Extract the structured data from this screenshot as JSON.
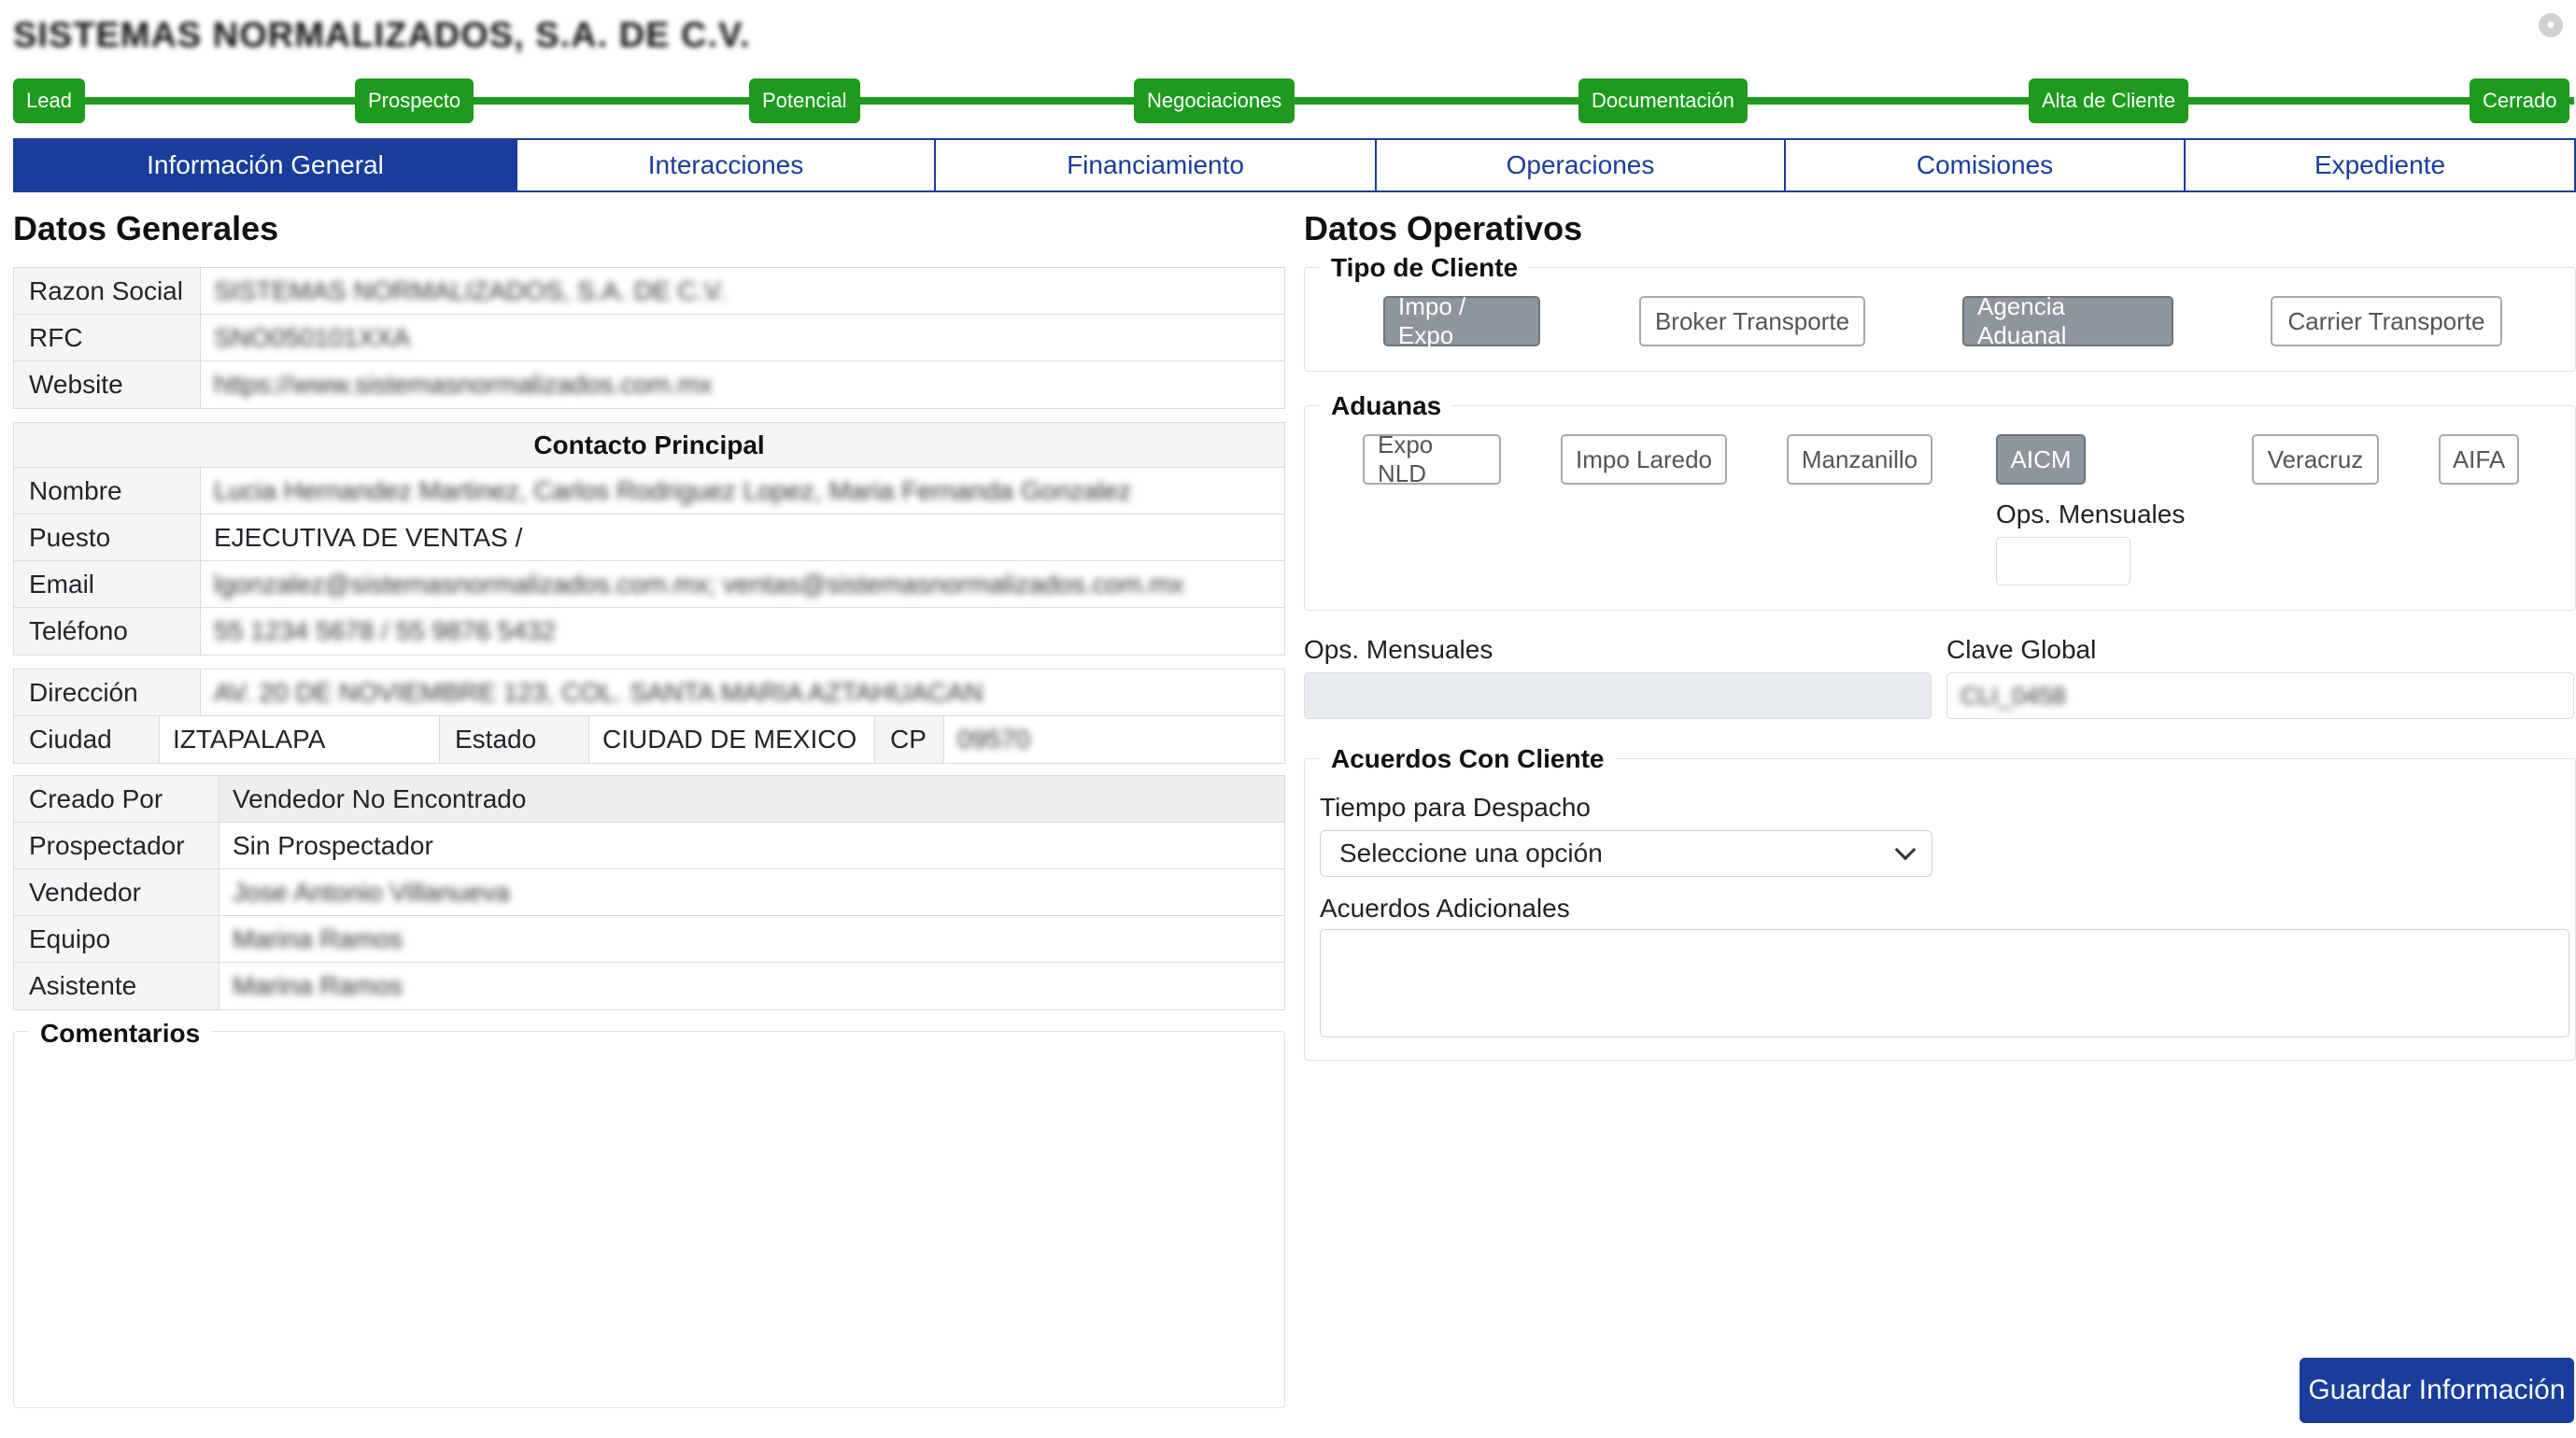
{
  "header": {
    "company_name": "SISTEMAS NORMALIZADOS, S.A. DE C.V."
  },
  "pipeline": {
    "stages": [
      "Lead",
      "Prospecto",
      "Potencial",
      "Negociaciones",
      "Documentación",
      "Alta de Cliente",
      "Cerrado"
    ],
    "color": "#1e9a1e"
  },
  "tabs": {
    "items": [
      "Información General",
      "Interacciones",
      "Financiamiento",
      "Operaciones",
      "Comisiones",
      "Expediente"
    ],
    "active": "Información General",
    "color": "#1a3d9c"
  },
  "datos_generales": {
    "title": "Datos Generales",
    "razon_social": {
      "label": "Razon Social",
      "value": "SISTEMAS NORMALIZADOS, S.A. DE C.V."
    },
    "rfc": {
      "label": "RFC",
      "value": "SNO050101XXA"
    },
    "website": {
      "label": "Website",
      "value": "https://www.sistemasnormalizados.com.mx"
    }
  },
  "contacto": {
    "title": "Contacto Principal",
    "nombre": {
      "label": "Nombre",
      "value": "Lucia Hernandez Martinez, Carlos Rodriguez Lopez, Maria Fernanda Gonzalez"
    },
    "puesto": {
      "label": "Puesto",
      "value": "EJECUTIVA DE VENTAS /"
    },
    "email": {
      "label": "Email",
      "value": "lgonzalez@sistemasnormalizados.com.mx; ventas@sistemasnormalizados.com.mx"
    },
    "telefono": {
      "label": "Teléfono",
      "value": "55 1234 5678 / 55 9876 5432"
    }
  },
  "direccion": {
    "direccion": {
      "label": "Dirección",
      "value": "AV. 20 DE NOVIEMBRE 123, COL. SANTA MARIA AZTAHUACAN"
    },
    "ciudad": {
      "label": "Ciudad",
      "value": "IZTAPALAPA"
    },
    "estado": {
      "label": "Estado",
      "value": "CIUDAD DE MEXICO"
    },
    "cp": {
      "label": "CP",
      "value": "09570"
    }
  },
  "asignacion": {
    "creado_por": {
      "label": "Creado Por",
      "value": "Vendedor No Encontrado"
    },
    "prospectador": {
      "label": "Prospectador",
      "value": "Sin Prospectador"
    },
    "vendedor": {
      "label": "Vendedor",
      "value": "Jose Antonio Villanueva"
    },
    "equipo": {
      "label": "Equipo",
      "value": "Marina Ramos"
    },
    "asistente": {
      "label": "Asistente",
      "value": "Marina Ramos"
    }
  },
  "comentarios": {
    "label": "Comentarios"
  },
  "datos_operativos": {
    "title": "Datos Operativos",
    "tipo_cliente": {
      "legend": "Tipo de Cliente",
      "options": [
        {
          "label": "Impo / Expo",
          "selected": true
        },
        {
          "label": "Broker Transporte",
          "selected": false
        },
        {
          "label": "Agencia Aduanal",
          "selected": true
        },
        {
          "label": "Carrier Transporte",
          "selected": false
        }
      ]
    },
    "aduanas": {
      "legend": "Aduanas",
      "options": [
        {
          "label": "Expo NLD",
          "selected": false
        },
        {
          "label": "Impo Laredo",
          "selected": false
        },
        {
          "label": "Manzanillo",
          "selected": false
        },
        {
          "label": "AICM",
          "selected": true
        },
        {
          "label": "Veracruz",
          "selected": false
        },
        {
          "label": "AIFA",
          "selected": false
        }
      ],
      "ops_label": "Ops. Mensuales"
    },
    "ops_mensuales": {
      "label": "Ops. Mensuales",
      "value": ""
    },
    "clave_global": {
      "label": "Clave Global",
      "value": "CLI_0458"
    }
  },
  "acuerdos": {
    "legend": "Acuerdos Con Cliente",
    "tiempo_label": "Tiempo para Despacho",
    "tiempo_value": "Seleccione una opción",
    "adicionales_label": "Acuerdos Adicionales"
  },
  "actions": {
    "save_label": "Guardar Información"
  }
}
